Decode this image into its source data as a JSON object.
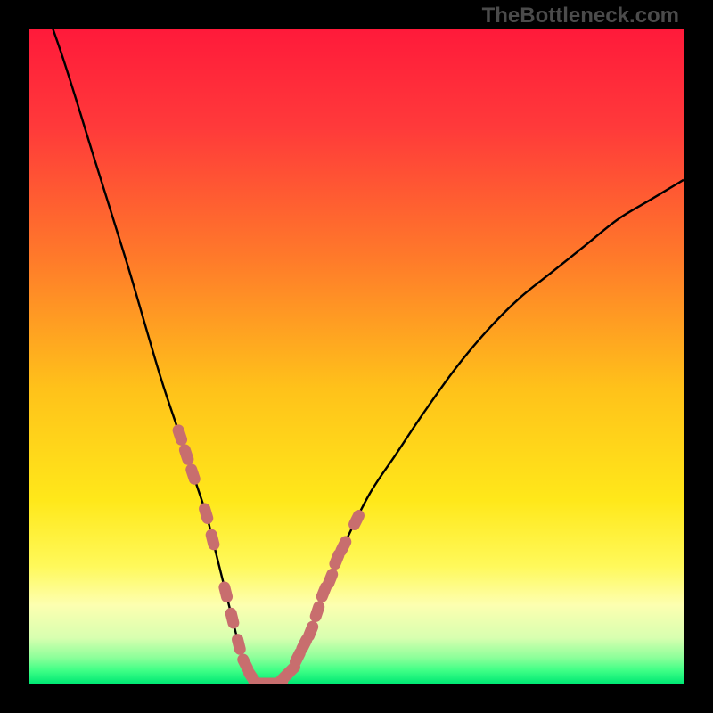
{
  "watermark": "TheBottleneck.com",
  "colors": {
    "page_bg": "#000000",
    "curve": "#000000",
    "marker": "#c86e6e",
    "marker_stroke": "#c86e6e",
    "gradient_stops": [
      {
        "offset": "0%",
        "color": "#ff1a3a"
      },
      {
        "offset": "15%",
        "color": "#ff3a3a"
      },
      {
        "offset": "35%",
        "color": "#ff7a2a"
      },
      {
        "offset": "55%",
        "color": "#ffc21a"
      },
      {
        "offset": "72%",
        "color": "#ffe81a"
      },
      {
        "offset": "82%",
        "color": "#fff95a"
      },
      {
        "offset": "88%",
        "color": "#fdffb0"
      },
      {
        "offset": "93%",
        "color": "#d8ffb0"
      },
      {
        "offset": "96%",
        "color": "#8dff9a"
      },
      {
        "offset": "98%",
        "color": "#3fff86"
      },
      {
        "offset": "100%",
        "color": "#00e874"
      }
    ]
  },
  "chart_data": {
    "type": "line",
    "title": "",
    "xlabel": "",
    "ylabel": "",
    "xlim": [
      0,
      100
    ],
    "ylim": [
      0,
      100
    ],
    "x": [
      0,
      5,
      10,
      15,
      20,
      23,
      25,
      27,
      28,
      29,
      30,
      31,
      32,
      33,
      34,
      35,
      36,
      38,
      39,
      40,
      41,
      42,
      44,
      45,
      48,
      52,
      56,
      60,
      65,
      70,
      75,
      80,
      85,
      90,
      95,
      100
    ],
    "y_curve": [
      110,
      96,
      80,
      64,
      47,
      38,
      32,
      26,
      22,
      18,
      14,
      10,
      6,
      3,
      1,
      0,
      0,
      0,
      1,
      2,
      4,
      6,
      11,
      14,
      21,
      29,
      35,
      41,
      48,
      54,
      59,
      63,
      67,
      71,
      74,
      77
    ],
    "markers_left": [
      {
        "x": 23,
        "y": 38
      },
      {
        "x": 24,
        "y": 35
      },
      {
        "x": 25,
        "y": 32
      },
      {
        "x": 27,
        "y": 26
      },
      {
        "x": 28,
        "y": 22
      },
      {
        "x": 30,
        "y": 14
      },
      {
        "x": 31,
        "y": 10
      },
      {
        "x": 32,
        "y": 6
      }
    ],
    "markers_bottom": [
      {
        "x": 33,
        "y": 3
      },
      {
        "x": 34,
        "y": 1
      },
      {
        "x": 35,
        "y": 0
      },
      {
        "x": 36,
        "y": 0
      },
      {
        "x": 37,
        "y": 0
      },
      {
        "x": 38,
        "y": 0
      },
      {
        "x": 39,
        "y": 1
      },
      {
        "x": 40,
        "y": 2
      }
    ],
    "markers_right": [
      {
        "x": 41,
        "y": 4
      },
      {
        "x": 42,
        "y": 6
      },
      {
        "x": 43,
        "y": 8
      },
      {
        "x": 44,
        "y": 11
      },
      {
        "x": 45,
        "y": 14
      },
      {
        "x": 46,
        "y": 16
      },
      {
        "x": 47,
        "y": 19
      },
      {
        "x": 48,
        "y": 21
      },
      {
        "x": 50,
        "y": 25
      }
    ]
  }
}
